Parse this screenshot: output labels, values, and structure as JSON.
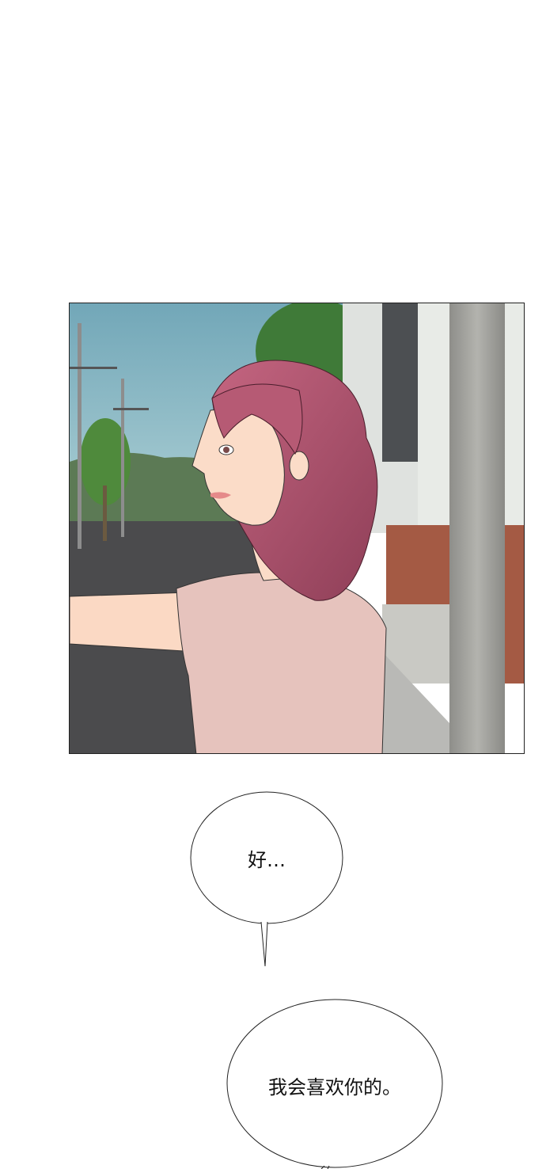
{
  "panel": {
    "scene": "illustrated-comic-panel",
    "colors": {
      "sky": "#7fb0c0",
      "hair": "#b65a74",
      "shirt": "#e6c3bd",
      "brick": "#a45a44",
      "pole": "#a8a8a4",
      "road": "#4b4b4d"
    }
  },
  "bubbles": [
    {
      "text": "好…"
    },
    {
      "text": "我会喜欢你的。"
    }
  ]
}
